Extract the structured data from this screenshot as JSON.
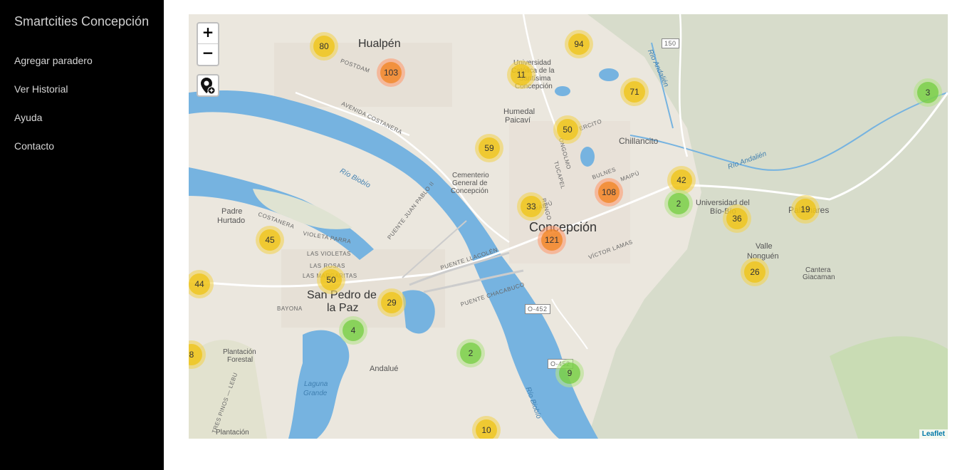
{
  "app": {
    "title": "Smartcities Concepción"
  },
  "sidebar": {
    "items": [
      {
        "label": "Agregar paradero"
      },
      {
        "label": "Ver Historial"
      },
      {
        "label": "Ayuda"
      },
      {
        "label": "Contacto"
      }
    ]
  },
  "map": {
    "zoom_in_label": "+",
    "zoom_out_label": "−",
    "add_stop_icon": "map-pin-plus-icon",
    "attribution": "Leaflet",
    "clusters": [
      {
        "count": "80",
        "size": "medium"
      },
      {
        "count": "103",
        "size": "large"
      },
      {
        "count": "11",
        "size": "medium"
      },
      {
        "count": "94",
        "size": "medium"
      },
      {
        "count": "71",
        "size": "medium"
      },
      {
        "count": "3",
        "size": "small"
      },
      {
        "count": "50",
        "size": "medium"
      },
      {
        "count": "59",
        "size": "medium"
      },
      {
        "count": "42",
        "size": "medium"
      },
      {
        "count": "108",
        "size": "large"
      },
      {
        "count": "2",
        "size": "small"
      },
      {
        "count": "19",
        "size": "medium"
      },
      {
        "count": "33",
        "size": "medium"
      },
      {
        "count": "36",
        "size": "medium"
      },
      {
        "count": "121",
        "size": "large"
      },
      {
        "count": "45",
        "size": "medium"
      },
      {
        "count": "26",
        "size": "medium"
      },
      {
        "count": "44",
        "size": "medium"
      },
      {
        "count": "50",
        "size": "medium"
      },
      {
        "count": "29",
        "size": "medium"
      },
      {
        "count": "4",
        "size": "small"
      },
      {
        "count": "8",
        "size": "medium"
      },
      {
        "count": "2",
        "size": "small"
      },
      {
        "count": "9",
        "size": "small"
      },
      {
        "count": "10",
        "size": "medium"
      }
    ],
    "labels": {
      "hualpen": "Hualpén",
      "concepcion": "Concepción",
      "san_pedro_1": "San Pedro de",
      "san_pedro_2": "la Paz",
      "chillancito": "Chillancito",
      "padre_hurtado_1": "Padre",
      "padre_hurtado_2": "Hurtado",
      "humedal_1": "Humedal",
      "humedal_2": "Paicaví",
      "cementerio_1": "Cementerio",
      "cementerio_2": "General de",
      "cementerio_3": "Concepción",
      "univ_biobio_1": "Universidad del",
      "univ_biobio_2": "Bío-Bío",
      "univ_catolica_1": "Universidad",
      "univ_catolica_2": "Católica de la",
      "univ_catolica_3": "Santísima",
      "univ_catolica_4": "Concepción",
      "valle_1": "Valle",
      "valle_2": "Nonguén",
      "cantera_1": "Cantera",
      "cantera_2": "Giacaman",
      "palomares": "Palomares",
      "andalue": "Andalué",
      "plantacion_1": "Plantación",
      "plantacion_2": "Forestal",
      "plantacion_3": "Plantación",
      "laguna_1": "Laguna",
      "laguna_2": "Grande",
      "bayona": "BAYONA",
      "rio_biobio_1": "Río Biobío",
      "rio_biobio_2": "Río Biobío",
      "rio_andalien_1": "Río Andalién",
      "rio_andalien_2": "Río Andalién",
      "costanera": "COSTANERA",
      "av_costanera": "AVENIDA COSTANERA",
      "violeta_parra": "VIOLETA PARRA",
      "las_violetas": "LAS VIOLETAS",
      "las_rosas": "LAS ROSAS",
      "las_margaritas": "LAS MARGARITAS",
      "puente_llacolen": "PUENTE LLACOLÉN",
      "puente_chacabuco": "PUENTE CHACABUCO",
      "puente_juan_pablo": "PUENTE JUAN PABLO II",
      "victor_lamas": "VÍCTOR LAMAS",
      "route_150": "150",
      "route_o452": "O-452",
      "route_o452b": "O-452",
      "postdam": "POSTDAM",
      "bulnes": "BULNES",
      "tucapel": "TUCAPEL",
      "maipu": "MAIPÚ",
      "maipu2": "MAIPÚ",
      "ercito": "ERCITO",
      "ongolmo": "ONGOLMO",
      "rengo": "RENGO",
      "tres_pinos": "TRES PINOS — LEBU"
    }
  }
}
